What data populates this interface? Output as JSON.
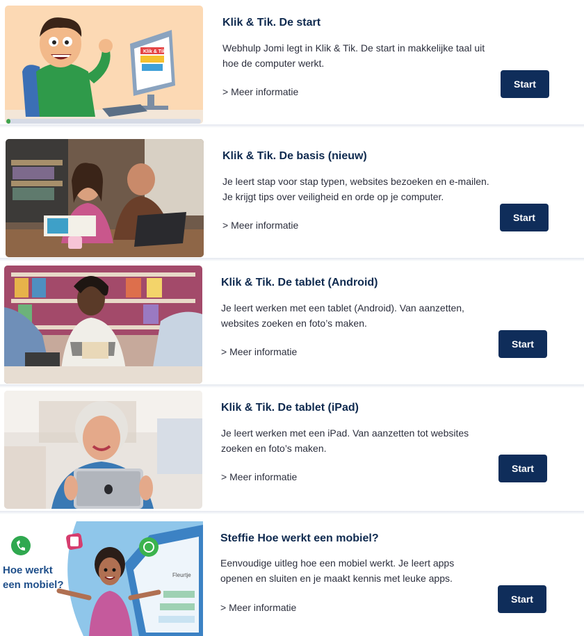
{
  "courses": [
    {
      "title": "Klik & Tik. De start",
      "description": "Webhulp Jomi legt in Klik & Tik. De start in makkelijke taal uit hoe de computer werkt.",
      "more_label": "> Meer informatie",
      "button_label": "Start",
      "progress_fraction": 0.02,
      "image_text": "Klik & Tik"
    },
    {
      "title": "Klik & Tik. De basis (nieuw)",
      "description": "Je leert stap voor stap typen, websites bezoeken en e-mailen. Je krijgt tips over veiligheid en orde op je computer.",
      "more_label": "> Meer informatie",
      "button_label": "Start"
    },
    {
      "title": "Klik & Tik. De tablet (Android)",
      "description": "Je leert werken met een tablet (Android). Van aanzetten, websites zoeken en foto’s maken.",
      "more_label": "> Meer informatie",
      "button_label": "Start"
    },
    {
      "title": "Klik & Tik. De tablet (iPad)",
      "description": "Je leert werken met een iPad. Van aanzetten tot websites zoeken en foto’s maken.",
      "more_label": "> Meer informatie",
      "button_label": "Start"
    },
    {
      "title": "Steffie Hoe werkt een mobiel?",
      "description": "Eenvoudige uitleg hoe een mobiel werkt. Je leert apps openen en sluiten en je maakt kennis met leuke apps.",
      "more_label": "> Meer informatie",
      "button_label": "Start",
      "image_text_line1": "Hoe werkt",
      "image_text_line2": "een mobiel?",
      "phone_label": "Fleurtje"
    }
  ],
  "colors": {
    "button_bg": "#0f2d5a",
    "title": "#0f2a4f",
    "progress_fill": "#3fa34d",
    "progress_track": "#d6dbe6"
  }
}
